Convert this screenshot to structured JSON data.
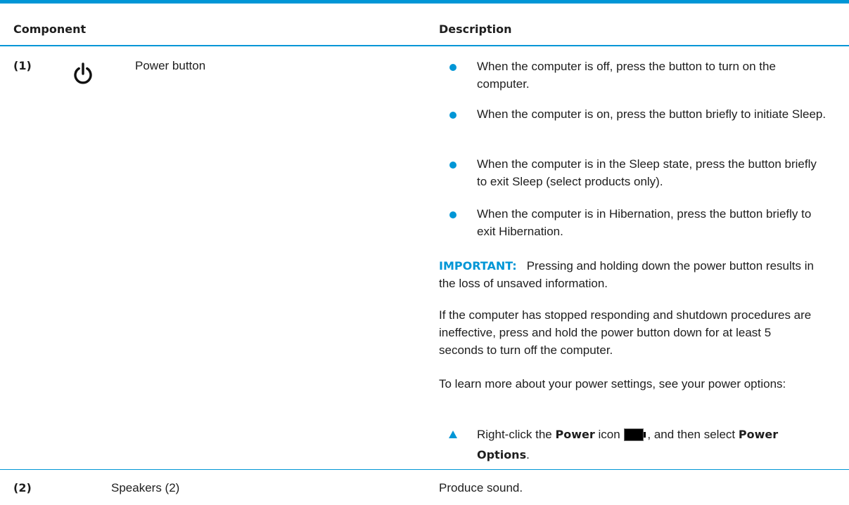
{
  "table": {
    "header": {
      "component": "Component",
      "description": "Description"
    },
    "rows": [
      {
        "number": "(1)",
        "icon": "power-icon",
        "name": "Power button",
        "bullets": [
          "When the computer is off, press the button to turn on the computer.",
          "When the computer is on, press the button briefly to initiate Sleep.",
          "When the computer is in the Sleep state, press the button briefly to exit Sleep (select products only).",
          "When the computer is in Hibernation, press the button briefly to exit Hibernation."
        ],
        "important_label": "IMPORTANT:",
        "important_text": "Pressing and holding down the power button results in the loss of unsaved information.",
        "paragraph_1": "If the computer has stopped responding and shutdown procedures are ineffective, press and hold the power button down for at least 5 seconds to turn off the computer.",
        "paragraph_2": "To learn more about your power settings, see your power options:",
        "step": {
          "prefix": "Right-click the ",
          "bold_1": "Power",
          "middle_1": " icon ",
          "icon": "battery-icon",
          "middle_2": ", and then select ",
          "bold_2": "Power",
          "break": "Options",
          "suffix": "."
        }
      },
      {
        "number": "(2)",
        "name": "Speakers (2)",
        "description": "Produce sound."
      }
    ]
  },
  "colors": {
    "accent": "#0096d6",
    "text": "#1e1e1e"
  }
}
